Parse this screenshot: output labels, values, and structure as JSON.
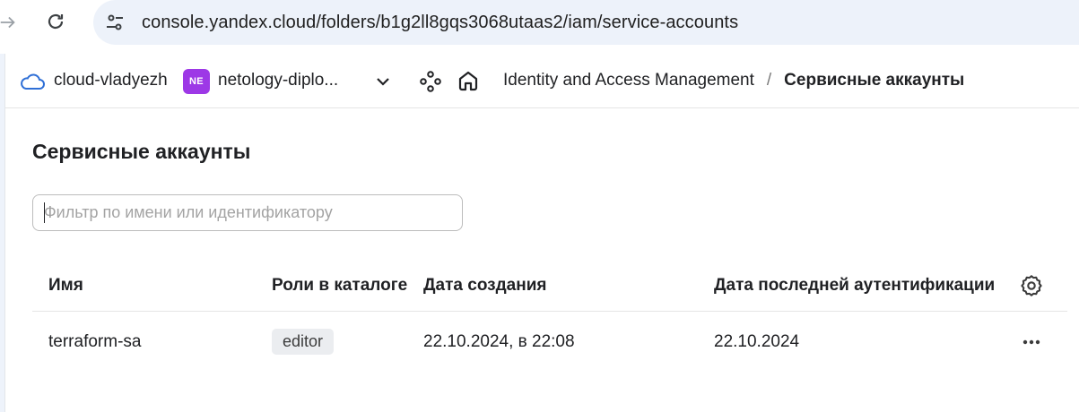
{
  "browser": {
    "url": "console.yandex.cloud/folders/b1g2ll8gqs3068utaas2/iam/service-accounts",
    "icons": {
      "forward": "arrow-right-icon",
      "reload": "reload-icon",
      "site_info": "tune-icon"
    }
  },
  "header": {
    "cloud_name": "cloud-vladyezh",
    "folder_badge": "NE",
    "folder_badge_color": "#9d38e6",
    "folder_name": "netology-diplo...",
    "breadcrumb": {
      "service": "Identity and Access Management",
      "separator": "/",
      "current": "Сервисные аккаунты"
    },
    "icons": {
      "cloud": "cloud-icon",
      "chevron": "chevron-down-icon",
      "services": "services-icon",
      "home": "home-icon"
    }
  },
  "main": {
    "title": "Сервисные аккаунты",
    "filter": {
      "value": "",
      "placeholder": "Фильтр по имени или идентификатору"
    },
    "table": {
      "columns": [
        "Имя",
        "Роли в каталоге",
        "Дата создания",
        "Дата последней аутентификации"
      ],
      "rows": [
        {
          "name": "terraform-sa",
          "role": "editor",
          "created": "22.10.2024, в 22:08",
          "last_auth": "22.10.2024"
        }
      ]
    }
  },
  "colors": {
    "accent": "#2f6fd6",
    "omnibox_bg": "#edf2fa",
    "chip_bg": "#ebedf0"
  }
}
